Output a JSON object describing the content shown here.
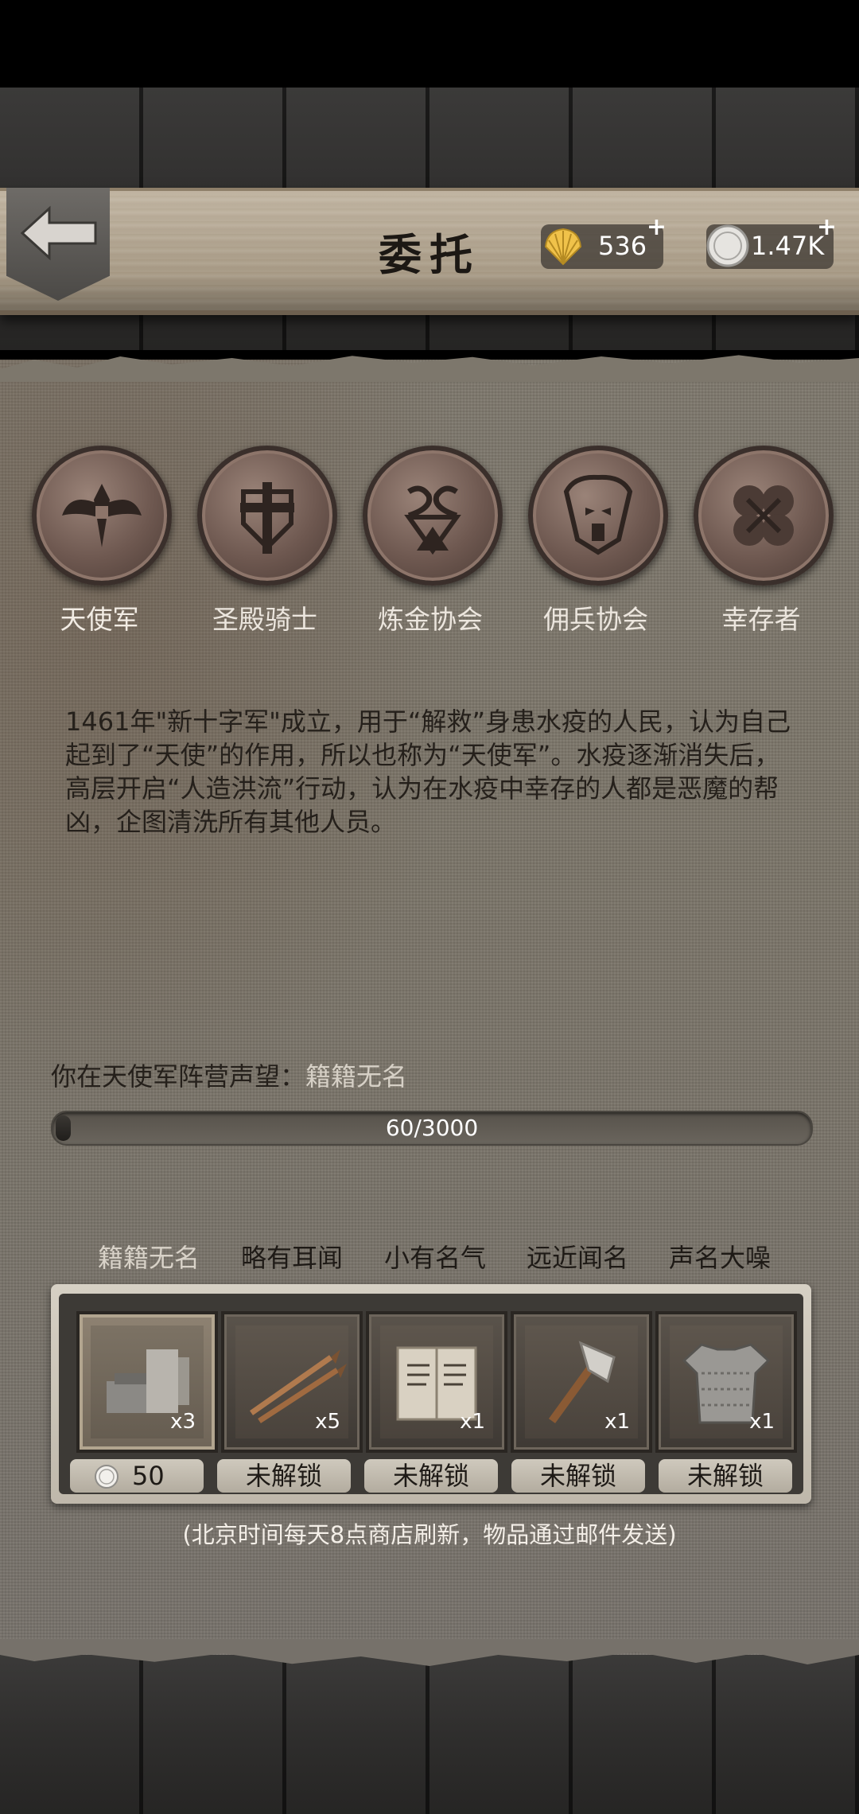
{
  "header": {
    "title": "委托",
    "shells": "536",
    "coins": "1.47K",
    "plus": "+"
  },
  "factions": [
    {
      "label": "天使军",
      "icon": "angel-wings-emblem"
    },
    {
      "label": "圣殿骑士",
      "icon": "cross-shield-emblem"
    },
    {
      "label": "炼金协会",
      "icon": "alchemy-serpent-emblem"
    },
    {
      "label": "佣兵协会",
      "icon": "horned-mask-emblem"
    },
    {
      "label": "幸存者",
      "icon": "clover-emblem"
    }
  ],
  "description": "1461年\"新十字军\"成立，用于“解救”身患水疫的人民，认为自己起到了“天使”的作用，所以也称为“天使军”。水疫逐渐消失后，高层开启“人造洪流”行动，认为在水疫中幸存的人都是恶魔的帮凶，企图清洗所有其他人员。",
  "reputation": {
    "prefix": "你在天使军阵营声望：",
    "level": "籍籍无名",
    "progress_text": "60/3000",
    "progress_fraction": 0.02
  },
  "tiers": [
    "籍籍无名",
    "略有耳闻",
    "小有名气",
    "远近闻名",
    "声名大噪"
  ],
  "shop": {
    "items": [
      {
        "icon": "anvil-hammer-icon",
        "qty": "x3",
        "price": "50"
      },
      {
        "icon": "bolts-icon",
        "qty": "x5",
        "price": "未解锁"
      },
      {
        "icon": "scroll-book-icon",
        "qty": "x1",
        "price": "未解锁"
      },
      {
        "icon": "axe-hammer-icon",
        "qty": "x1",
        "price": "未解锁"
      },
      {
        "icon": "chainmail-icon",
        "qty": "x1",
        "price": "未解锁"
      }
    ],
    "note": "(北京时间每天8点商店刷新，物品通过邮件发送)"
  },
  "colors": {
    "parchment": "#7a7468",
    "wood": "#2f2e2d",
    "medal": "#6e5850",
    "highlight_text": "#d8d2c8"
  }
}
